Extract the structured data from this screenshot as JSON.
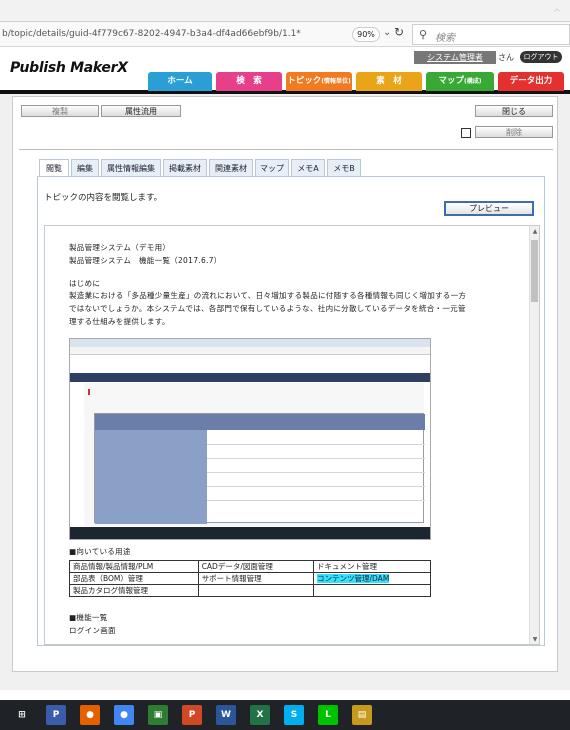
{
  "browser": {
    "url": "b/topic/details/guid-4f779c67-8202-4947-b3a4-df4ad66ebf9b/1.1*",
    "zoom": "90%",
    "search_placeholder": "検索"
  },
  "app": {
    "logo": "Publish MakerX",
    "system_admin": "システム管理者",
    "user_suffix": "さん",
    "logout": "ログアウト"
  },
  "nav": [
    {
      "label": "ホーム",
      "sub": "",
      "color": "#2a9fd6"
    },
    {
      "label": "検　索",
      "sub": "",
      "color": "#e83f8a"
    },
    {
      "label": "トピック",
      "sub": "(情報単位)",
      "color": "#f27a21"
    },
    {
      "label": "素　材",
      "sub": "",
      "color": "#e9a418"
    },
    {
      "label": "マップ",
      "sub": "(構成)",
      "color": "#39a935"
    },
    {
      "label": "データ出力",
      "sub": "",
      "color": "#e4312f"
    }
  ],
  "toolbar": {
    "copy": "複製",
    "attr_reuse": "属性流用",
    "close": "閉じる",
    "delete": "削除"
  },
  "tabs": [
    {
      "label": "閲覧",
      "active": true
    },
    {
      "label": "編集"
    },
    {
      "label": "属性情報編集"
    },
    {
      "label": "掲載素材"
    },
    {
      "label": "関連素材"
    },
    {
      "label": "マップ"
    },
    {
      "label": "メモA"
    },
    {
      "label": "メモB"
    }
  ],
  "panel": {
    "description": "トピックの内容を閲覧します。",
    "preview_button": "プレビュー"
  },
  "document": {
    "line1": "製品管理システム（デモ用）",
    "line2": "製品管理システム　機能一覧（2017.6.7）",
    "line3": "はじめに",
    "line4": "製造業における「多品種少量生産」の流れにおいて、日々増加する製品に付随する各種情報も同じく増加する一方",
    "line5": "ではないでしょうか。本システムでは、各部門で保有しているような、社内に分散しているデータを統合・一元管",
    "line6": "理する仕組みを提供します。",
    "usage_heading": "■向いている用途",
    "usage_table": [
      [
        "商品情報/製品情報/PLM",
        "CADデータ/図面管理",
        "ドキュメント管理"
      ],
      [
        "部品表（BOM）管理",
        "サポート情報管理",
        "コンテンツ管理/DAM"
      ],
      [
        "製品カタログ情報管理",
        "",
        ""
      ]
    ],
    "features_heading": "■機能一覧",
    "login_screen": "ログイン画面"
  },
  "taskbar": [
    {
      "name": "windows-start-icon",
      "glyph": "⊞",
      "color": "#1f2327"
    },
    {
      "name": "file-app-icon",
      "glyph": "P",
      "color": "#3a5dab"
    },
    {
      "name": "firefox-icon",
      "glyph": "●",
      "color": "#e66000"
    },
    {
      "name": "chrome-icon",
      "glyph": "●",
      "color": "#4285f4"
    },
    {
      "name": "image-app-icon",
      "glyph": "▣",
      "color": "#2e7d32"
    },
    {
      "name": "powerpoint-icon",
      "glyph": "P",
      "color": "#d24726"
    },
    {
      "name": "word-icon",
      "glyph": "W",
      "color": "#2b579a"
    },
    {
      "name": "excel-icon",
      "glyph": "X",
      "color": "#217346"
    },
    {
      "name": "skype-icon",
      "glyph": "S",
      "color": "#00aff0"
    },
    {
      "name": "line-icon",
      "glyph": "L",
      "color": "#00c300"
    },
    {
      "name": "folder-app-icon",
      "glyph": "▤",
      "color": "#c79a1e"
    }
  ]
}
